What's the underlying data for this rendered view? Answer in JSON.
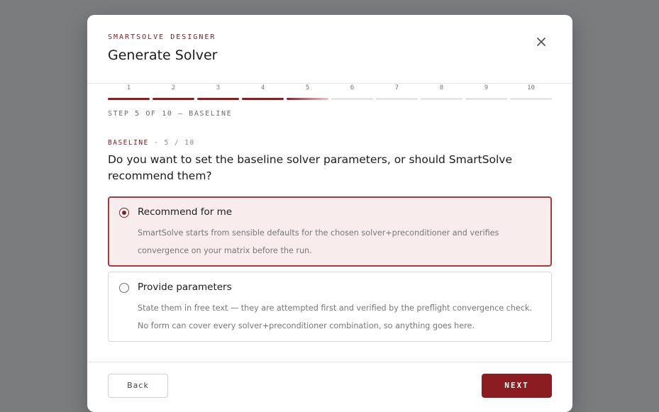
{
  "modal": {
    "eyebrow": "SMARTSOLVE DESIGNER",
    "title": "Generate Solver",
    "close_icon": "close-icon"
  },
  "stepper": {
    "current": 5,
    "total": 10,
    "steps": [
      "1",
      "2",
      "3",
      "4",
      "5",
      "6",
      "7",
      "8",
      "9",
      "10"
    ],
    "caption": "STEP 5 OF 10 — BASELINE"
  },
  "section": {
    "name": "BASELINE",
    "count": "· 5 / 10",
    "question": "Do you want to set the baseline solver parameters, or should SmartSolve recommend them?"
  },
  "options": [
    {
      "title": "Recommend for me",
      "line1": "SmartSolve starts from sensible defaults for the chosen solver+preconditioner and verifies",
      "line2": "convergence on your matrix before the run.",
      "selected": true
    },
    {
      "title": "Provide parameters",
      "line1": "State them in free text — they are attempted first and verified by the preflight convergence check.",
      "line2": "No form can cover every solver+preconditioner combination, so anything goes here.",
      "selected": false
    }
  ],
  "footer": {
    "back_label": "Back",
    "next_label": "NEXT"
  },
  "colors": {
    "accent": "#8a1c22",
    "selected_bg": "#f8eced",
    "overlay": "#7b7c7e"
  }
}
